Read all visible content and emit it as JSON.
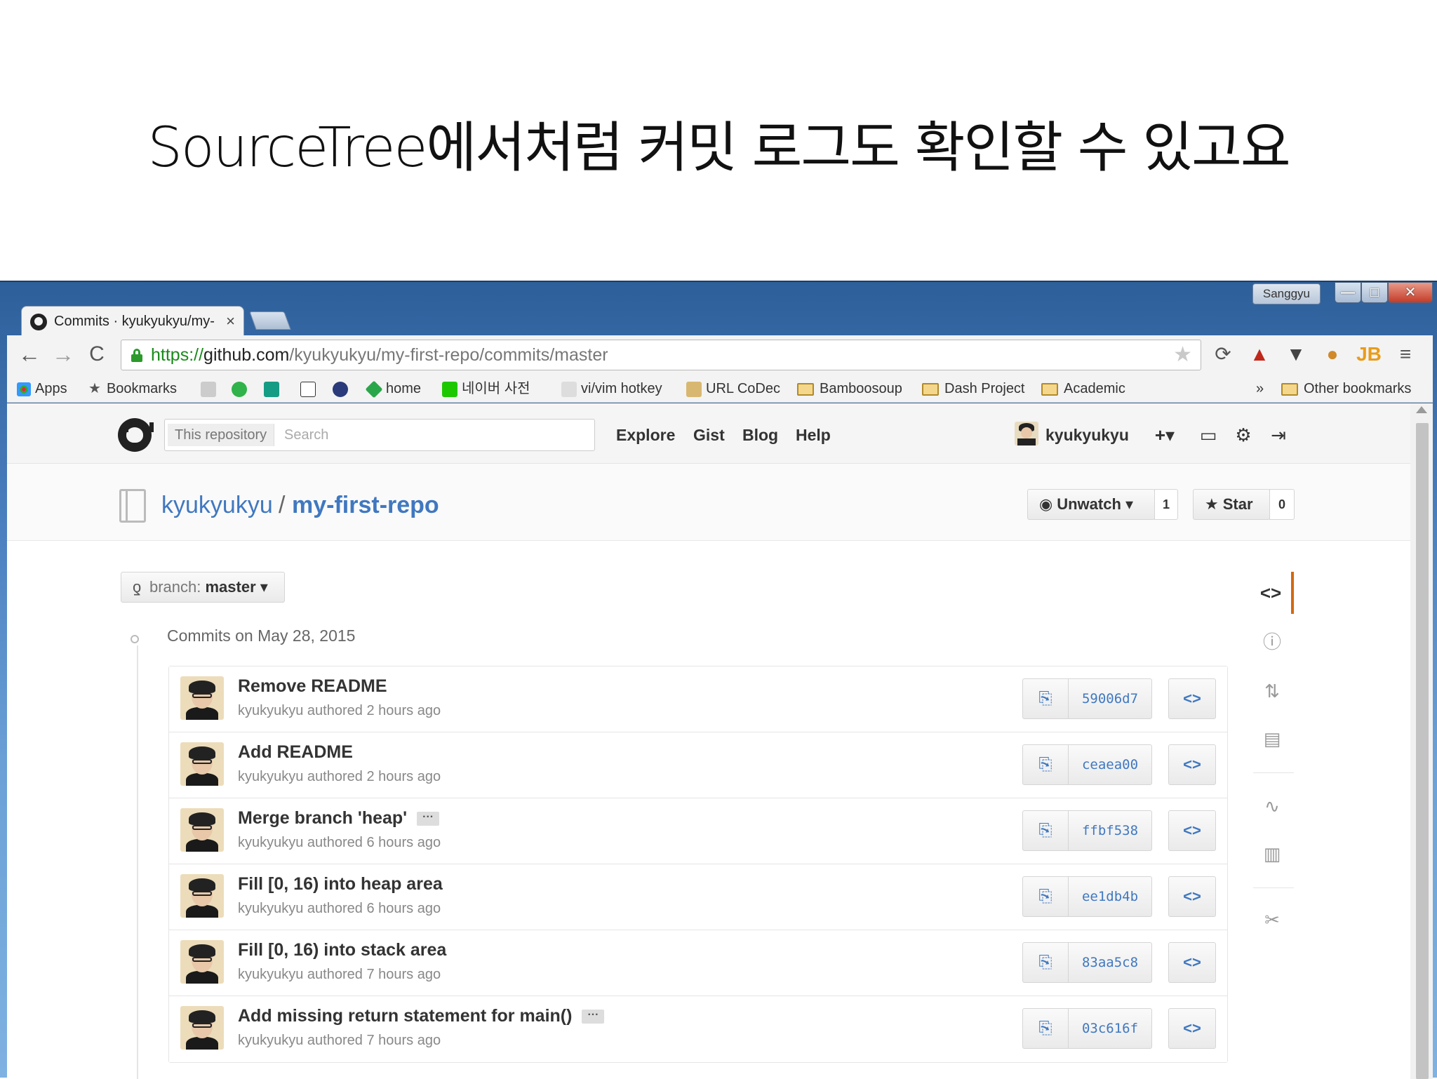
{
  "slide": {
    "title": "SourceTree에서처럼 커밋 로그도 확인할 수 있고요"
  },
  "window": {
    "user_label": "Sanggyu",
    "minimize_glyph": "—",
    "maximize_glyph": "□",
    "close_glyph": "✕"
  },
  "browser": {
    "tab_title": "Commits · kyukyukyu/my-",
    "tab_close": "×",
    "url_scheme": "https://",
    "url_host": "github.com",
    "url_path": "/kyukyukyu/my-first-repo/commits/master",
    "back_glyph": "←",
    "forward_glyph": "→",
    "reload_glyph": "C",
    "star_glyph": "★",
    "extension_icons": [
      "sync-icon",
      "hat-icon",
      "pocket-icon",
      "cookie-icon",
      "jetbrains-icon"
    ],
    "menu_glyph": "≡",
    "bookmarks": {
      "apps": "Apps",
      "bookmarks": "Bookmarks",
      "home": "home",
      "naver": "네이버 사전",
      "vim": "vi/vim hotkey",
      "urlcodec": "URL CoDec",
      "bamboosoup": "Bamboosoup",
      "dash": "Dash Project",
      "academic": "Academic",
      "overflow": "»",
      "other": "Other bookmarks"
    }
  },
  "github": {
    "search_scope": "This repository",
    "search_placeholder": "Search",
    "nav": [
      "Explore",
      "Gist",
      "Blog",
      "Help"
    ],
    "username": "kyukyukyu",
    "header_icons": {
      "plus": "+▾",
      "inbox": "▭",
      "settings": "⚙",
      "signout": "⇥"
    },
    "repo_owner": "kyukyukyu",
    "repo_separator": "/",
    "repo_name": "my-first-repo",
    "unwatch_label": "Unwatch ▾",
    "unwatch_icon": "◉",
    "watch_count": "1",
    "star_label": "Star",
    "star_icon": "★",
    "star_count": "0",
    "branch_prefix": "branch: ",
    "branch_value": "master",
    "branch_caret": " ▾",
    "branch_icon": "ƍ",
    "commits_date": "Commits on May 28, 2015"
  },
  "commits": [
    {
      "title": "Remove README",
      "author": "kyukyukyu",
      "meta": " authored 2 hours ago",
      "sha": "59006d7",
      "has_more": false
    },
    {
      "title": "Add README",
      "author": "kyukyukyu",
      "meta": " authored 2 hours ago",
      "sha": "ceaea00",
      "has_more": false
    },
    {
      "title": "Merge branch 'heap'",
      "author": "kyukyukyu",
      "meta": " authored 6 hours ago",
      "sha": "ffbf538",
      "has_more": true
    },
    {
      "title": "Fill [0, 16) into heap area",
      "author": "kyukyukyu",
      "meta": " authored 6 hours ago",
      "sha": "ee1db4b",
      "has_more": false
    },
    {
      "title": "Fill [0, 16) into stack area",
      "author": "kyukyukyu",
      "meta": " authored 7 hours ago",
      "sha": "83aa5c8",
      "has_more": false
    },
    {
      "title": "Add missing return statement for main()",
      "author": "kyukyukyu",
      "meta": " authored 7 hours ago",
      "sha": "03c616f",
      "has_more": true
    }
  ],
  "commit_buttons": {
    "copy_glyph": "⎘",
    "browse_glyph": "<>",
    "more_glyph": "···"
  },
  "side_nav": {
    "code": "<>",
    "issues": "ⓘ",
    "pulls": "⇅",
    "wiki": "▤",
    "pulse": "∿",
    "graphs": "▥",
    "settings": "✂"
  },
  "colors": {
    "link": "#4078c0",
    "accent_orange": "#d26911",
    "https_green": "#1a8a1a"
  }
}
